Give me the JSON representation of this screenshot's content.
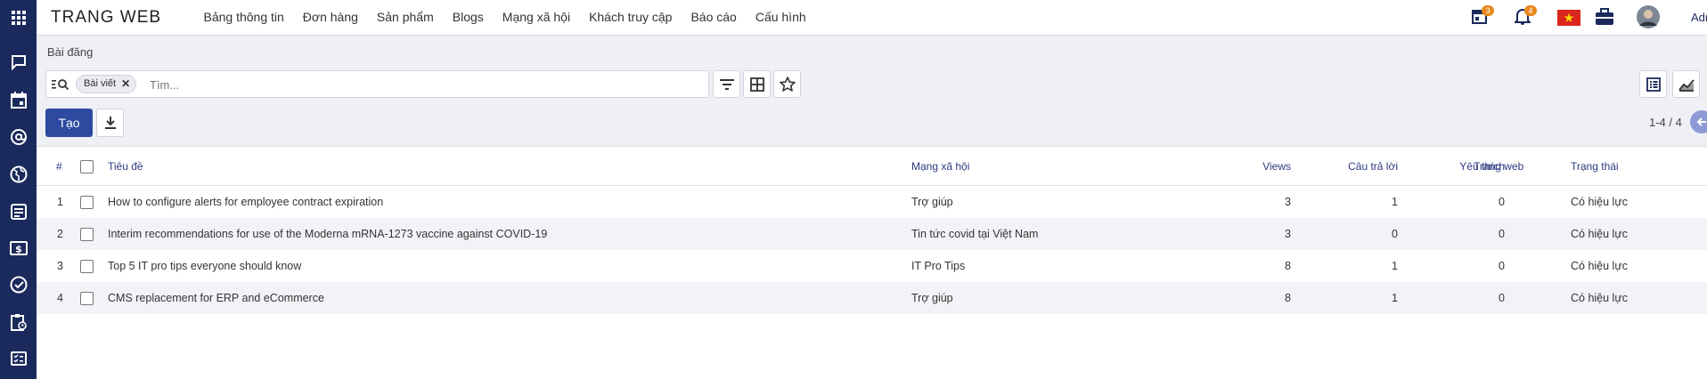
{
  "app": {
    "brand": "TRANG WEB",
    "menu": [
      "Bảng thông tin",
      "Đơn hàng",
      "Sản phẩm",
      "Blogs",
      "Mạng xã hội",
      "Khách truy cập",
      "Báo cáo",
      "Cấu hình"
    ],
    "calendar_badge": "3",
    "notification_badge": "4",
    "user": "Admin"
  },
  "sidebar": {
    "icons": [
      "apps-grid-icon",
      "chat-icon",
      "calendar-icon",
      "at-sign-icon",
      "globe-icon",
      "article-icon",
      "money-icon",
      "check-circle-icon",
      "clipboard-clock-icon",
      "checklist-icon"
    ]
  },
  "control": {
    "breadcrumb": "Bài đăng",
    "facet": "Bài viết",
    "search_placeholder": "Tìm...",
    "create_label": "Tạo",
    "pager": "1-4 / 4"
  },
  "table": {
    "headers": {
      "num": "#",
      "title": "Tiêu đề",
      "social": "Mạng xã hội",
      "views": "Views",
      "replies": "Câu trả lời",
      "likes": "Yêu thích",
      "website": "Trang web",
      "status": "Trạng thái"
    },
    "rows": [
      {
        "num": "1",
        "title": "How to configure alerts for employee contract expiration",
        "social": "Trợ giúp",
        "views": "3",
        "replies": "1",
        "likes": "0",
        "status": "Có hiệu lực"
      },
      {
        "num": "2",
        "title": "Interim recommendations for use of the Moderna mRNA-1273 vaccine against COVID-19",
        "social": "Tin tức covid tại Việt Nam",
        "views": "3",
        "replies": "0",
        "likes": "0",
        "status": "Có hiệu lực"
      },
      {
        "num": "3",
        "title": "Top 5 IT pro tips everyone should know",
        "social": "IT Pro Tips",
        "views": "8",
        "replies": "1",
        "likes": "0",
        "status": "Có hiệu lực"
      },
      {
        "num": "4",
        "title": "CMS replacement for ERP and eCommerce",
        "social": "Trợ giúp",
        "views": "8",
        "replies": "1",
        "likes": "0",
        "status": "Có hiệu lực"
      }
    ]
  },
  "colors": {
    "sidebar": "#1b2a5c",
    "primary": "#2e4aa0",
    "badge": "#e8891c",
    "pager_button": "#8d9ad6"
  }
}
